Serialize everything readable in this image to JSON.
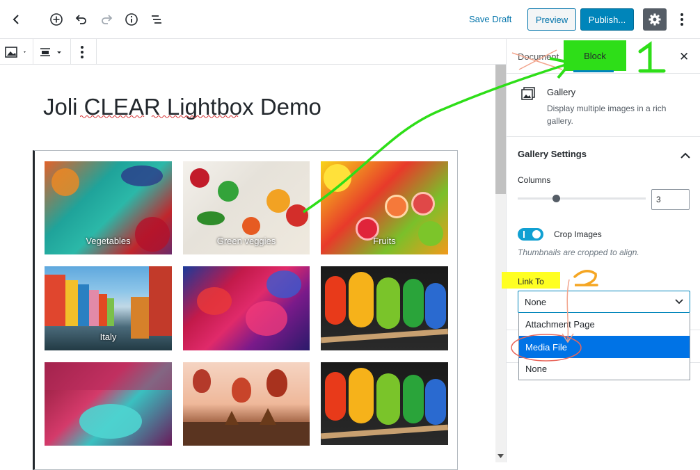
{
  "header": {
    "save_draft": "Save Draft",
    "preview": "Preview",
    "publish": "Publish...",
    "icons": [
      "back-chevron-icon",
      "add-block-icon",
      "undo-icon",
      "redo-icon",
      "info-icon",
      "outline-icon",
      "settings-gear-icon",
      "more-vertical-icon"
    ]
  },
  "block_toolbar": {
    "icons": [
      "gallery-icon",
      "align-icon",
      "more-vertical-icon"
    ]
  },
  "post": {
    "title": "Joli CLEAR Lightbox Demo"
  },
  "gallery": {
    "images": [
      {
        "caption": "Vegetables",
        "theme": "vegetables"
      },
      {
        "caption": "Green veggies",
        "theme": "green-veggies"
      },
      {
        "caption": "Fruits",
        "theme": "fruits"
      },
      {
        "caption": "Italy",
        "theme": "italy"
      },
      {
        "caption": "",
        "theme": "holi"
      },
      {
        "caption": "",
        "theme": "parrots"
      },
      {
        "caption": "",
        "theme": "holi-crowd"
      },
      {
        "caption": "",
        "theme": "balloons"
      },
      {
        "caption": "",
        "theme": "parrots"
      }
    ]
  },
  "sidebar": {
    "tab_document": "Document",
    "tab_block": "Block",
    "block_card": {
      "name": "Gallery",
      "description": "Display multiple images in a rich gallery."
    },
    "gallery_settings": {
      "title": "Gallery Settings",
      "columns_label": "Columns",
      "columns_value": "3",
      "columns_min": 1,
      "columns_max": 8,
      "crop_label": "Crop Images",
      "crop_enabled": true,
      "crop_hint": "Thumbnails are cropped to align.",
      "link_to_label": "Link To",
      "link_to_value": "None",
      "link_to_options": [
        "Attachment Page",
        "Media File",
        "None"
      ],
      "link_to_highlighted": "Media File"
    }
  },
  "annotations": {
    "step1": "1",
    "step2": "2"
  },
  "colors": {
    "accent": "#0085ba",
    "annotation_green": "#2ede18",
    "annotation_yellow": "#ffff22",
    "annotation_orange": "#f5a623",
    "annotation_red": "#e8675c"
  }
}
